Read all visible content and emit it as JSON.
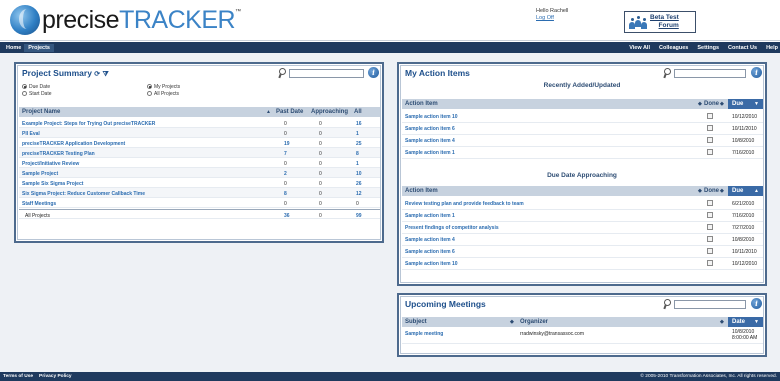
{
  "brand": {
    "name_part1": "precise",
    "name_part2": "TRACKER",
    "trademark": "™"
  },
  "user": {
    "greeting": "Hello Rachell",
    "logout": "Log Off"
  },
  "beta_forum": {
    "line1": "Beta Test",
    "line2": "Forum"
  },
  "nav": {
    "left": [
      "Home",
      "Projects"
    ],
    "right": [
      "View All",
      "Colleagues",
      "Settings",
      "Contact Us",
      "Help"
    ]
  },
  "project_summary": {
    "title": "Project Summary",
    "search_placeholder": "",
    "options": {
      "due_date": "Due Date",
      "start_date": "Start Date",
      "my_projects": "My Projects",
      "all_projects": "All Projects"
    },
    "columns": [
      "Project Name",
      "Past Date",
      "Approaching",
      "All"
    ],
    "rows": [
      {
        "name": "Example Project: Steps for Trying Out preciseTRACKER",
        "past": "0",
        "approaching": "0",
        "all": "16"
      },
      {
        "name": "PII Eval",
        "past": "0",
        "approaching": "0",
        "all": "1"
      },
      {
        "name": "preciseTRACKER Application Development",
        "past": "19",
        "approaching": "0",
        "all": "25"
      },
      {
        "name": "preciseTRACKER Testing Plan",
        "past": "7",
        "approaching": "0",
        "all": "8"
      },
      {
        "name": "Project/Initiative Review",
        "past": "0",
        "approaching": "0",
        "all": "1"
      },
      {
        "name": "Sample Project",
        "past": "2",
        "approaching": "0",
        "all": "10"
      },
      {
        "name": "Sample Six Sigma Project",
        "past": "0",
        "approaching": "0",
        "all": "26"
      },
      {
        "name": "Six Sigma Project: Reduce Customer Callback Time",
        "past": "8",
        "approaching": "0",
        "all": "12"
      },
      {
        "name": "Staff Meetings",
        "past": "0",
        "approaching": "0",
        "all": "0"
      }
    ],
    "total": {
      "name": "All Projects",
      "past": "36",
      "approaching": "0",
      "all": "99"
    }
  },
  "action_items": {
    "title": "My Action Items",
    "recent_heading": "Recently Added/Updated",
    "approaching_heading": "Due Date Approaching",
    "columns": [
      "Action Item",
      "Done",
      "Due"
    ],
    "recent": [
      {
        "name": "Sample action item 10",
        "due": "10/12/2010"
      },
      {
        "name": "Sample action item 6",
        "due": "10/11/2010"
      },
      {
        "name": "Sample action item 4",
        "due": "10/8/2010"
      },
      {
        "name": "Sample action item 1",
        "due": "7/16/2010"
      }
    ],
    "approaching": [
      {
        "name": "Review testing plan and provide feedback to team",
        "due": "6/21/2010"
      },
      {
        "name": "Sample action item 1",
        "due": "7/16/2010"
      },
      {
        "name": "Present findings of competitor analysis",
        "due": "7/27/2010"
      },
      {
        "name": "Sample action item 4",
        "due": "10/8/2010"
      },
      {
        "name": "Sample action item 6",
        "due": "10/11/2010"
      },
      {
        "name": "Sample action item 10",
        "due": "10/12/2010"
      }
    ]
  },
  "meetings": {
    "title": "Upcoming Meetings",
    "columns": [
      "Subject",
      "Organizer",
      "Date"
    ],
    "rows": [
      {
        "subject": "Sample meeting",
        "organizer": "rradwinsky@transassoc.com",
        "date_line1": "10/8/2010",
        "date_line2": "8:00:00 AM"
      }
    ]
  },
  "footer": {
    "links": [
      "Terms of Use",
      "Privacy Policy"
    ],
    "copyright": "© 2005-2010 Transformation Associates, Inc. All rights reserved."
  },
  "colors": {
    "nav": "#1f3a5e",
    "panel_border": "#4d6a8d",
    "link": "#2b6cb0",
    "header_row": "#c7d2df",
    "sort_active": "#3a6aa6"
  }
}
